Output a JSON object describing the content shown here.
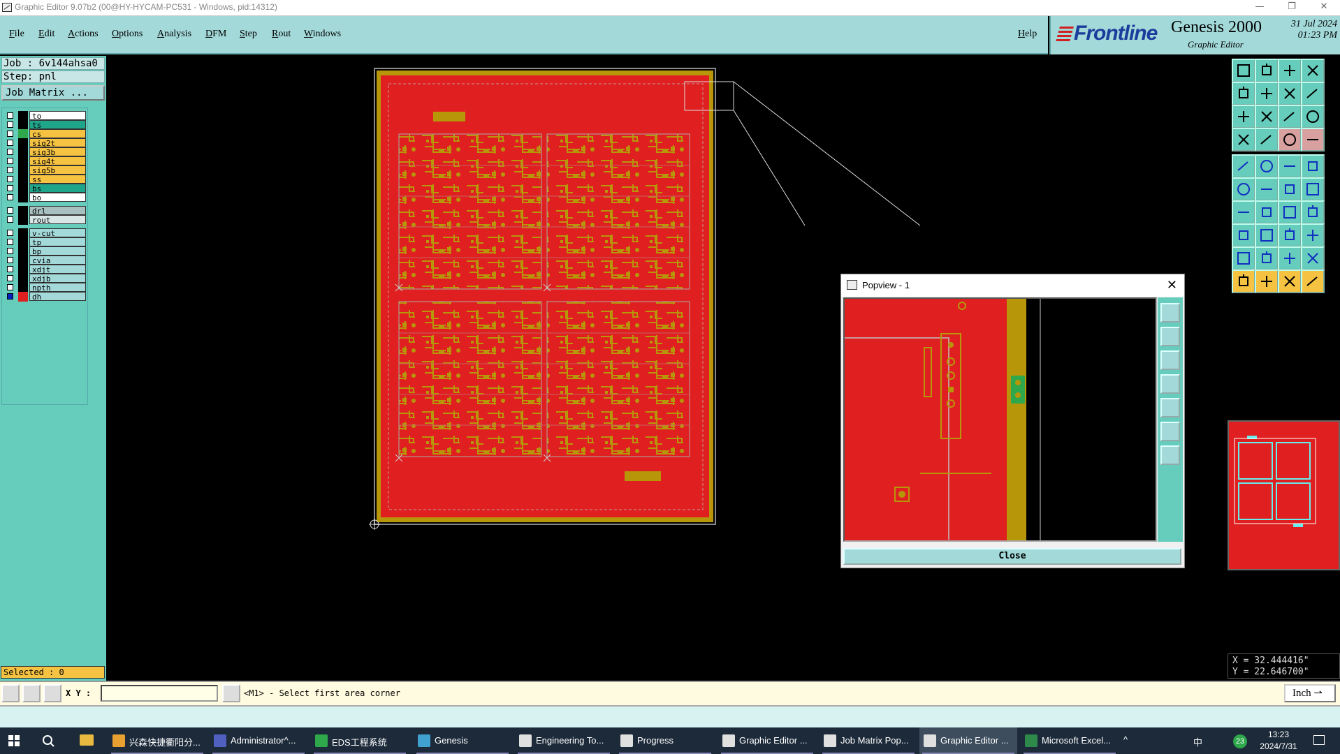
{
  "window": {
    "title": "Graphic Editor 9.07b2 (00@HY-HYCAM-PC531 - Windows, pid:14312)",
    "controls": {
      "minimize": "—",
      "restore": "❐",
      "close": "✕"
    }
  },
  "menu": {
    "items": [
      {
        "label": "File"
      },
      {
        "label": "Edit"
      },
      {
        "label": "Actions"
      },
      {
        "label": "Options"
      },
      {
        "label": "Analysis"
      },
      {
        "label": "DFM"
      },
      {
        "label": "Step"
      },
      {
        "label": "Rout"
      },
      {
        "label": "Windows"
      }
    ],
    "help": "Help"
  },
  "brand": {
    "logo": "Frontline",
    "product": "Genesis 2000",
    "subtitle": "Graphic Editor",
    "date": "31 Jul 2024",
    "time": "01:23 PM"
  },
  "left_panel": {
    "job": "Job : 6v144ahsa0",
    "step": "Step: pnl",
    "job_matrix_button": "Job Matrix ...",
    "layers": [
      {
        "name": "to",
        "bg": "#ffffff",
        "swatch": "#000000"
      },
      {
        "name": "ts",
        "bg": "#1fa58a",
        "swatch": "#000000"
      },
      {
        "name": "cs",
        "bg": "#f5c242",
        "swatch": "#2ea84a"
      },
      {
        "name": "sig2t",
        "bg": "#f5c242",
        "swatch": "#000000"
      },
      {
        "name": "sig3b",
        "bg": "#f5c242",
        "swatch": "#000000"
      },
      {
        "name": "sig4t",
        "bg": "#f5c242",
        "swatch": "#000000"
      },
      {
        "name": "sig5b",
        "bg": "#f5c242",
        "swatch": "#000000"
      },
      {
        "name": "ss",
        "bg": "#f5c242",
        "swatch": "#000000"
      },
      {
        "name": "bs",
        "bg": "#1fa58a",
        "swatch": "#000000"
      },
      {
        "name": "bo",
        "bg": "#ffffff",
        "swatch": "#000000"
      },
      {
        "name": "drl",
        "bg": "#a9c0c0",
        "swatch": "#000000"
      },
      {
        "name": "rout",
        "bg": "#d8e6e6",
        "swatch": "#000000"
      },
      {
        "name": "v-cut",
        "bg": "#a3d9d9",
        "swatch": "#000000"
      },
      {
        "name": "tp",
        "bg": "#a3d9d9",
        "swatch": "#000000"
      },
      {
        "name": "bp",
        "bg": "#a3d9d9",
        "swatch": "#000000"
      },
      {
        "name": "cvia",
        "bg": "#a3d9d9",
        "swatch": "#000000"
      },
      {
        "name": "xdjt",
        "bg": "#a3d9d9",
        "swatch": "#000000"
      },
      {
        "name": "xdjb",
        "bg": "#a3d9d9",
        "swatch": "#000000"
      },
      {
        "name": "npth",
        "bg": "#a3d9d9",
        "swatch": "#000000"
      },
      {
        "name": "dh",
        "bg": "#a3d9d9",
        "swatch": "#e02020",
        "active": true
      }
    ],
    "selected": "Selected : 0"
  },
  "popview": {
    "title": "Popview - 1",
    "close_label": "Close"
  },
  "coords": {
    "x": "X = 32.444416\"",
    "y": "Y = 22.646700\""
  },
  "command_row": {
    "xy_label": "X Y :",
    "xy_value": "",
    "prompt": "<M1> - Select first area corner",
    "units": "Inch"
  },
  "taskbar": {
    "items": [
      {
        "label": "兴森快捷衢阳分...",
        "color": "#e8a030"
      },
      {
        "label": "Administrator^...",
        "color": "#5060c0"
      },
      {
        "label": "EDS工程系统",
        "color": "#2ea84a"
      },
      {
        "label": "Genesis",
        "color": "#40a0d0"
      },
      {
        "label": "Engineering To...",
        "color": "#e0e0e0"
      },
      {
        "label": "Progress",
        "color": "#e0e0e0"
      },
      {
        "label": "Graphic Editor ...",
        "color": "#e0e0e0"
      },
      {
        "label": "Job Matrix Pop...",
        "color": "#e0e0e0"
      },
      {
        "label": "Graphic Editor ...",
        "color": "#e0e0e0",
        "active": true
      },
      {
        "label": "Microsoft Excel...",
        "color": "#2e8a4a"
      }
    ],
    "tray_lang": "中",
    "tray_badge": "23",
    "clock_time": "13:23",
    "clock_date": "2024/7/31"
  },
  "colors": {
    "panel_teal": "#66ccbb",
    "menu_teal": "#a3d9d9",
    "board_red": "#e02020",
    "copper_gold": "#b8960a"
  }
}
